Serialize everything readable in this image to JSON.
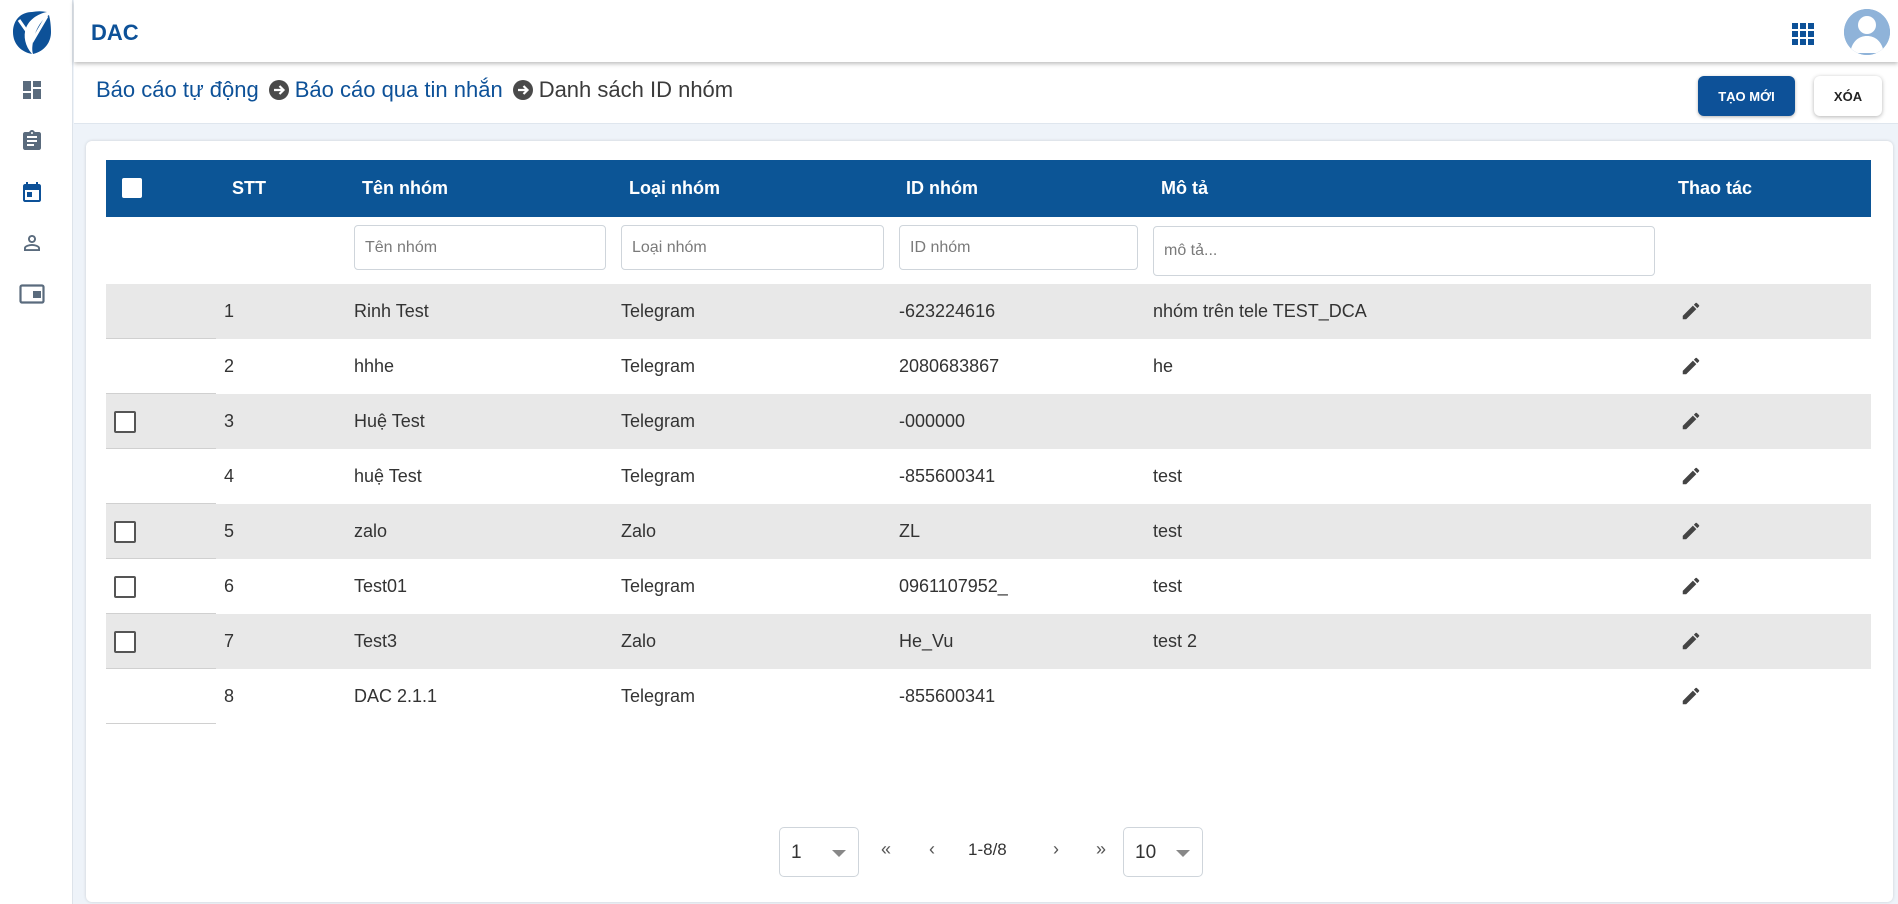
{
  "app": {
    "title": "DAC"
  },
  "sidebar": {
    "items": [
      {
        "name": "dashboard"
      },
      {
        "name": "clipboard"
      },
      {
        "name": "calendar"
      },
      {
        "name": "user"
      },
      {
        "name": "window"
      }
    ]
  },
  "breadcrumb": {
    "items": [
      "Báo cáo tự động",
      "Báo cáo qua tin nhắn",
      "Danh sách ID nhóm"
    ]
  },
  "actions": {
    "create_label": "TẠO MỚI",
    "delete_label": "XÓA"
  },
  "table": {
    "columns": [
      "STT",
      "Tên nhóm",
      "Loại nhóm",
      "ID nhóm",
      "Mô tả",
      "Thao tác"
    ],
    "filters": {
      "name_placeholder": "Tên nhóm",
      "type_placeholder": "Loại nhóm",
      "id_placeholder": "ID nhóm",
      "desc_placeholder": "mô tả..."
    },
    "rows": [
      {
        "stt": "1",
        "name": "Rinh Test",
        "type": "Telegram",
        "id": "-623224616",
        "desc": "nhóm trên tele TEST_DCA",
        "checkbox": false
      },
      {
        "stt": "2",
        "name": "hhhe",
        "type": "Telegram",
        "id": "2080683867",
        "desc": "he",
        "checkbox": false
      },
      {
        "stt": "3",
        "name": "Huệ Test",
        "type": "Telegram",
        "id": "-000000",
        "desc": "",
        "checkbox": true
      },
      {
        "stt": "4",
        "name": "huệ Test",
        "type": "Telegram",
        "id": "-855600341",
        "desc": "test",
        "checkbox": false
      },
      {
        "stt": "5",
        "name": "zalo",
        "type": "Zalo",
        "id": "ZL",
        "desc": "test",
        "checkbox": true
      },
      {
        "stt": "6",
        "name": "Test01",
        "type": "Telegram",
        "id": "0961107952_",
        "desc": "test",
        "checkbox": true
      },
      {
        "stt": "7",
        "name": "Test3",
        "type": "Zalo",
        "id": "He_Vu",
        "desc": "test 2",
        "checkbox": true
      },
      {
        "stt": "8",
        "name": "DAC 2.1.1",
        "type": "Telegram",
        "id": "-855600341",
        "desc": "",
        "checkbox": false
      }
    ]
  },
  "pagination": {
    "page": "1",
    "first": "«",
    "prev": "‹",
    "info": "1-8/8",
    "next": "›",
    "last": "»",
    "page_size": "10"
  },
  "colors": {
    "brand": "#0d5198",
    "header": "#0c5596",
    "row_shade": "#e8e8e8"
  }
}
